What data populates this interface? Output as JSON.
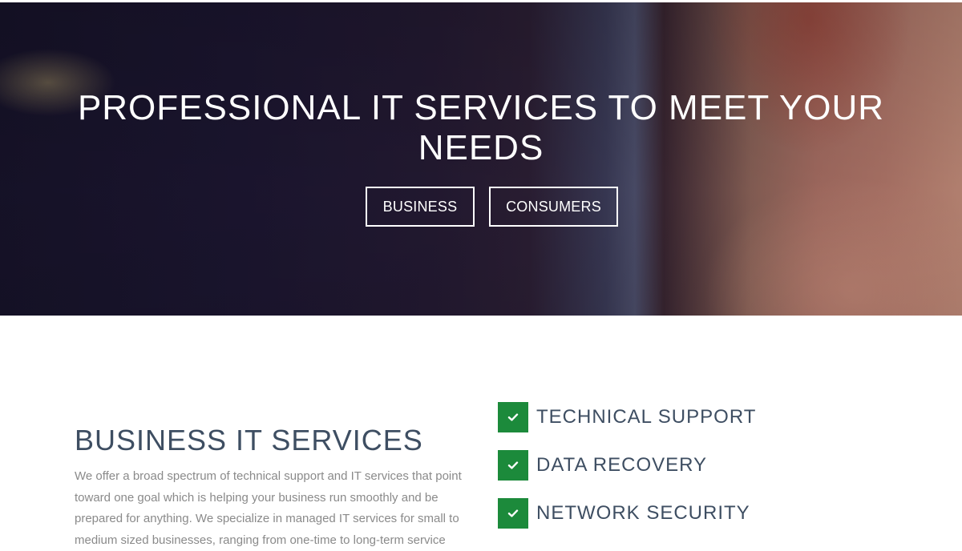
{
  "hero": {
    "title": "PROFESSIONAL IT SERVICES TO MEET YOUR NEEDS",
    "buttons": {
      "business": "BUSINESS",
      "consumers": "CONSUMERS"
    }
  },
  "business_section": {
    "title": "BUSINESS IT SERVICES",
    "body": "We offer a broad spectrum of technical support and IT services that point toward one goal which is helping your business run smoothly and be prepared for anything. We specialize in managed IT services for small to medium sized businesses, ranging from one-time to long-term service"
  },
  "features": [
    {
      "label": "TECHNICAL SUPPORT",
      "icon": "check-icon"
    },
    {
      "label": "DATA RECOVERY",
      "icon": "check-icon"
    },
    {
      "label": "NETWORK SECURITY",
      "icon": "check-icon"
    }
  ],
  "colors": {
    "accent_green": "#1c8a3b",
    "heading": "#3e4e62",
    "body_text": "#8a8a8a"
  }
}
